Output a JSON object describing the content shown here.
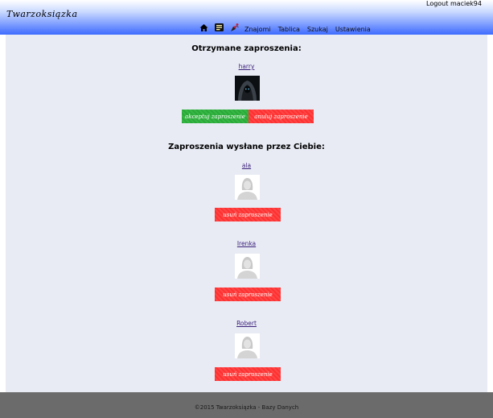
{
  "header": {
    "brand": "Twarzoksiązka",
    "logout_label": "Logout",
    "username": "maciek94",
    "nav_icons": [
      "home-icon",
      "messages-icon",
      "notifications-icon"
    ],
    "nav": [
      "Znajomi",
      "Tablica",
      "Szukaj",
      "Ustawienia"
    ]
  },
  "received": {
    "title": "Otrzymane zaproszenia:",
    "items": [
      {
        "user": "harry",
        "accept_label": "akceptuj zaproszenie",
        "decline_label": "anuluj zaproszenie"
      }
    ]
  },
  "sent": {
    "title": "Zaproszenia wysłane przez Ciebie:",
    "items": [
      {
        "user": "ala",
        "remove_label": "usuń zaproszenie"
      },
      {
        "user": "Irenka",
        "remove_label": "usuń zaproszenie"
      },
      {
        "user": "Robert",
        "remove_label": "usuń zaproszenie"
      }
    ]
  },
  "footer": {
    "text": "©2015 Twarzoksiązka - Bazy Danych"
  },
  "colors": {
    "accept": "#2ca83a",
    "decline": "#ff3030",
    "header_bottom": "#3f6bff",
    "main_bg": "#e8ebf4",
    "footer_bg": "#6b6b6b"
  }
}
